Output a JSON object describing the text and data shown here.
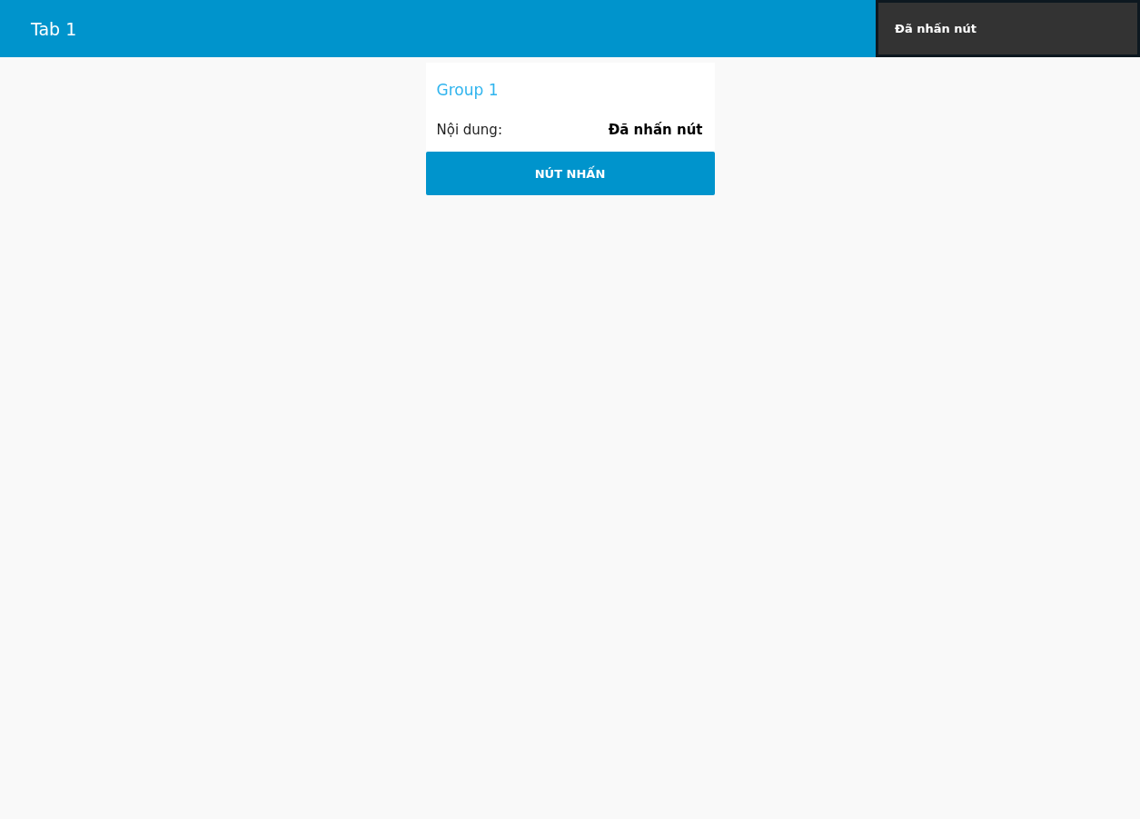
{
  "header": {
    "title": "Tab 1"
  },
  "toast": {
    "message": "Đã nhấn nút"
  },
  "group": {
    "title": "Group 1",
    "rows": [
      {
        "label": "Nội dung:",
        "value": "Đã nhấn nút"
      }
    ],
    "button": {
      "label": "NÚT NHẤN"
    }
  }
}
